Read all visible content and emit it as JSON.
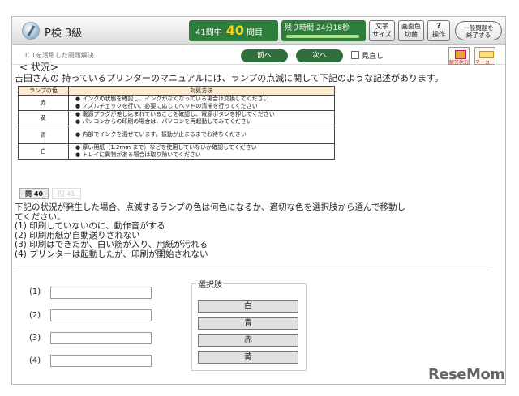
{
  "header": {
    "exam_name": "P検 3級",
    "question_prefix": "41問中",
    "current_question": "40",
    "question_suffix": "問目",
    "timer_text": "残り時間:24分18秒",
    "text_size_label": [
      "文字",
      "サイズ"
    ],
    "screen_color_label": [
      "画面色",
      "切替"
    ],
    "help_label": [
      "?",
      "操作"
    ],
    "end_label": [
      "一般問題を",
      "終了する"
    ]
  },
  "subbar": {
    "category": "ICTを活用した問題解決",
    "prev_label": "前へ",
    "next_label": "次へ",
    "review_label": "見直し",
    "status_label": "解答状況",
    "marker_label": "マーカー"
  },
  "situation": {
    "title": "< 状況>",
    "text": "吉田さんの 持っているプリンターのマニュアルには、ランプの点滅に関して下記のような記述があります。"
  },
  "table": {
    "headers": [
      "ランプの色",
      "対処方法"
    ],
    "rows": [
      {
        "color": "赤",
        "lines": [
          "● インクの状態を確認し、インクがなくなっている場合は交換してください",
          "● ノズルチェックを行い、必要に応じてヘッドの清掃を行ってください"
        ]
      },
      {
        "color": "黄",
        "lines": [
          "● 電源プラグが差し込まれていることを確認し、電源ボタンを押してください",
          "● パソコンからの印刷の場合は、パソコンを再起動してみてください"
        ]
      },
      {
        "color": "青",
        "lines": [
          "● 内部でインクを混ぜています。振動が止まるまでお待ちください"
        ]
      },
      {
        "color": "白",
        "lines": [
          "● 厚い用紙（1.2mm まで）などを使用していないか確認してください",
          "● トレイに異物がある場合は取り除いてください"
        ]
      }
    ]
  },
  "tabs": {
    "active": "問 40",
    "inactive": "問 41"
  },
  "question": {
    "lines": [
      "下記の状況が発生した場合、点滅するランプの色は何色になるか、適切な色を選択肢から選んで移動し",
      "てください。",
      "(1) 印刷していないのに、動作音がする",
      "(2) 印刷用紙が自動送りされない",
      "(3) 印刷はできたが、白い筋が入り、用紙が汚れる",
      "(4) プリンターは起動したが、印刷が開始されない"
    ]
  },
  "answers": [
    "(1)",
    "(2)",
    "(3)",
    "(4)"
  ],
  "choices": {
    "title": "選択肢",
    "items": [
      "白",
      "青",
      "赤",
      "黄"
    ]
  },
  "watermark": "ReseMom",
  "colors": {
    "header_green": "#2e7d3a",
    "question_number": "#ffd21a",
    "table_header": "#fbe9d0"
  }
}
